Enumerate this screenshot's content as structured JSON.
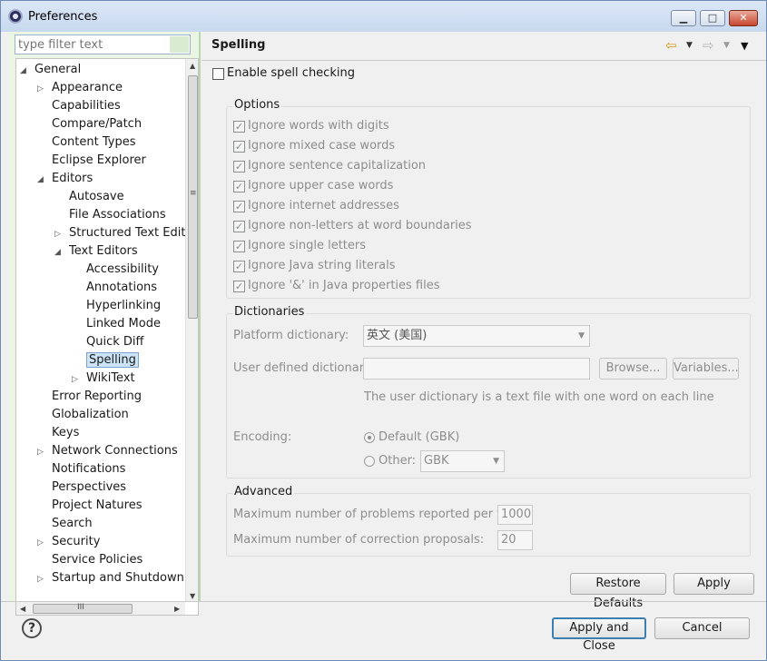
{
  "window": {
    "title": "Preferences",
    "app_icon": "eclipse-icon",
    "buttons": {
      "minimize": "▁",
      "maximize": "□",
      "close": "✕"
    }
  },
  "filter": {
    "placeholder": "type filter text"
  },
  "tree": {
    "items": [
      {
        "label": "General",
        "level": 0,
        "twisty": "expanded"
      },
      {
        "label": "Appearance",
        "level": 1,
        "twisty": "collapsed"
      },
      {
        "label": "Capabilities",
        "level": 1,
        "twisty": "none"
      },
      {
        "label": "Compare/Patch",
        "level": 1,
        "twisty": "none"
      },
      {
        "label": "Content Types",
        "level": 1,
        "twisty": "none"
      },
      {
        "label": "Eclipse Explorer",
        "level": 1,
        "twisty": "none"
      },
      {
        "label": "Editors",
        "level": 1,
        "twisty": "expanded"
      },
      {
        "label": "Autosave",
        "level": 2,
        "twisty": "none"
      },
      {
        "label": "File Associations",
        "level": 2,
        "twisty": "none"
      },
      {
        "label": "Structured Text Edit",
        "level": 2,
        "twisty": "collapsed"
      },
      {
        "label": "Text Editors",
        "level": 2,
        "twisty": "expanded"
      },
      {
        "label": "Accessibility",
        "level": 3,
        "twisty": "none"
      },
      {
        "label": "Annotations",
        "level": 3,
        "twisty": "none"
      },
      {
        "label": "Hyperlinking",
        "level": 3,
        "twisty": "none"
      },
      {
        "label": "Linked Mode",
        "level": 3,
        "twisty": "none"
      },
      {
        "label": "Quick Diff",
        "level": 3,
        "twisty": "none"
      },
      {
        "label": "Spelling",
        "level": 3,
        "twisty": "none",
        "selected": true
      },
      {
        "label": "WikiText",
        "level": 3,
        "twisty": "collapsed"
      },
      {
        "label": "Error Reporting",
        "level": 1,
        "twisty": "none"
      },
      {
        "label": "Globalization",
        "level": 1,
        "twisty": "none"
      },
      {
        "label": "Keys",
        "level": 1,
        "twisty": "none"
      },
      {
        "label": "Network Connections",
        "level": 1,
        "twisty": "collapsed"
      },
      {
        "label": "Notifications",
        "level": 1,
        "twisty": "none"
      },
      {
        "label": "Perspectives",
        "level": 1,
        "twisty": "none"
      },
      {
        "label": "Project Natures",
        "level": 1,
        "twisty": "none"
      },
      {
        "label": "Search",
        "level": 1,
        "twisty": "none"
      },
      {
        "label": "Security",
        "level": 1,
        "twisty": "collapsed"
      },
      {
        "label": "Service Policies",
        "level": 1,
        "twisty": "none"
      },
      {
        "label": "Startup and Shutdown",
        "level": 1,
        "twisty": "collapsed"
      }
    ],
    "scroll_marker": "≡",
    "hscroll_marker": "III"
  },
  "page": {
    "title": "Spelling",
    "enable_label": "Enable spell checking",
    "enable_checked": false
  },
  "options": {
    "title": "Options",
    "items": [
      "Ignore words with digits",
      "Ignore mixed case words",
      "Ignore sentence capitalization",
      "Ignore upper case words",
      "Ignore internet addresses",
      "Ignore non-letters at word boundaries",
      "Ignore single letters",
      "Ignore Java string literals",
      "Ignore '&' in Java properties files"
    ],
    "checked": true
  },
  "dictionaries": {
    "title": "Dictionaries",
    "platform_label": "Platform dictionary:",
    "platform_value": "英文 (美国)",
    "user_label": "User defined dictionary:",
    "user_value": "",
    "browse_label": "Browse...",
    "variables_label": "Variables...",
    "hint": "The user dictionary is a text file with one word on each line",
    "encoding_label": "Encoding:",
    "default_label": "Default (GBK)",
    "other_label": "Other:",
    "other_value": "GBK"
  },
  "advanced": {
    "title": "Advanced",
    "max_problems_label": "Maximum number of problems reported per file:",
    "max_problems_value": "1000",
    "max_proposals_label": "Maximum number of correction proposals:",
    "max_proposals_value": "20"
  },
  "buttons": {
    "restore_defaults": "Restore Defaults",
    "apply": "Apply",
    "apply_and_close": "Apply and Close",
    "cancel": "Cancel",
    "help": "?"
  },
  "colors": {
    "tree_bg": "#eaf5e4",
    "selection": "#cde4f7",
    "accent": "#3c7fb1"
  }
}
